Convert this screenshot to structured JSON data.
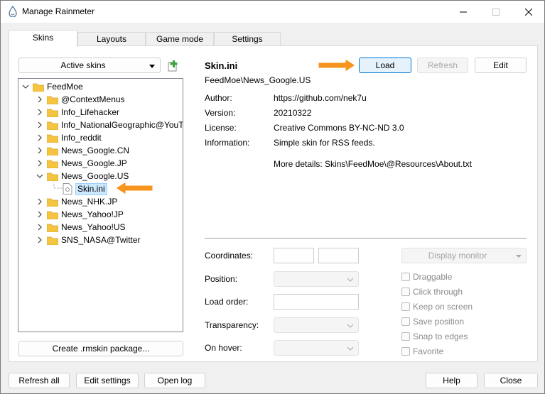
{
  "window": {
    "title": "Manage Rainmeter"
  },
  "tabs": [
    {
      "label": "Skins",
      "active": true
    },
    {
      "label": "Layouts",
      "active": false
    },
    {
      "label": "Game mode",
      "active": false
    },
    {
      "label": "Settings",
      "active": false
    }
  ],
  "left": {
    "active_skins_label": "Active skins",
    "create_package_label": "Create .rmskin package..."
  },
  "tree": {
    "root": "FeedMoe",
    "items": [
      "@ContextMenus",
      "Info_Lifehacker",
      "Info_NationalGeographic@YouT",
      "Info_reddit",
      "News_Google.CN",
      "News_Google.JP",
      "News_Google.US",
      "Skin.ini",
      "News_NHK.JP",
      "News_Yahoo!JP",
      "News_Yahoo!US",
      "SNS_NASA@Twitter"
    ]
  },
  "skin": {
    "name": "Skin.ini",
    "path": "FeedMoe\\News_Google.US",
    "load_label": "Load",
    "refresh_label": "Refresh",
    "edit_label": "Edit",
    "author_label": "Author:",
    "author": "https://github.com/nek7u",
    "version_label": "Version:",
    "version": "20210322",
    "license_label": "License:",
    "license": "Creative Commons BY-NC-ND 3.0",
    "information_label": "Information:",
    "information": "Simple skin for RSS feeds.",
    "more_details": "More details: Skins\\FeedMoe\\@Resources\\About.txt"
  },
  "settings": {
    "coordinates_label": "Coordinates:",
    "position_label": "Position:",
    "load_order_label": "Load order:",
    "transparency_label": "Transparency:",
    "on_hover_label": "On hover:",
    "display_monitor_label": "Display monitor",
    "checkboxes": [
      "Draggable",
      "Click through",
      "Keep on screen",
      "Save position",
      "Snap to edges",
      "Favorite"
    ]
  },
  "footer": {
    "refresh_all_label": "Refresh all",
    "edit_settings_label": "Edit settings",
    "open_log_label": "Open log",
    "help_label": "Help",
    "close_label": "Close"
  },
  "colors": {
    "accent": "#0078d4",
    "arrow": "#f7941d",
    "folder": "#f5c542"
  }
}
